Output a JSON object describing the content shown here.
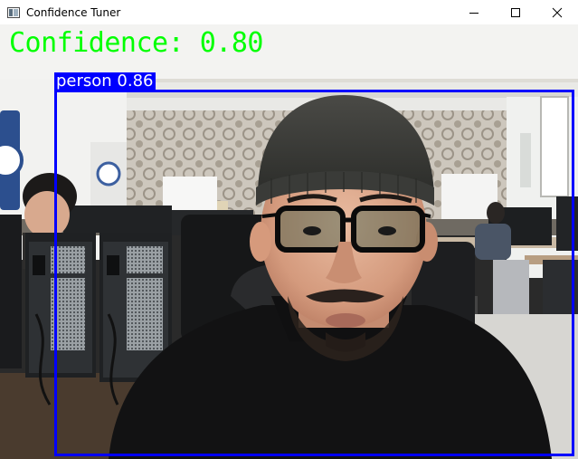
{
  "window": {
    "title": "Confidence Tuner",
    "controls": {
      "minimize_icon": "minimize-icon",
      "maximize_icon": "maximize-icon",
      "close_icon": "close-icon"
    }
  },
  "overlay": {
    "confidence_text": "Confidence: 0.80",
    "confidence_color": "#00ff00"
  },
  "detections": [
    {
      "label_text": "person 0.86",
      "label": "person",
      "score": 0.86,
      "box_color": "#0000ff"
    }
  ]
}
